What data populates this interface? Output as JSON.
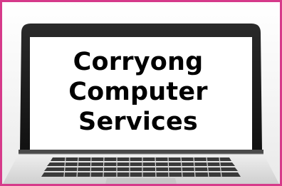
{
  "frame": {
    "border_color": "#d63a8a"
  },
  "laptop": {
    "icon": "laptop-icon",
    "screen_color": "#ffffff",
    "bezel_color": "#1a1a1a",
    "body_color": "#d7d7d7",
    "key_color": "#3a3a3a"
  },
  "screen": {
    "line_1": "Corryong",
    "line_2": "Computer",
    "line_3": "Services"
  }
}
